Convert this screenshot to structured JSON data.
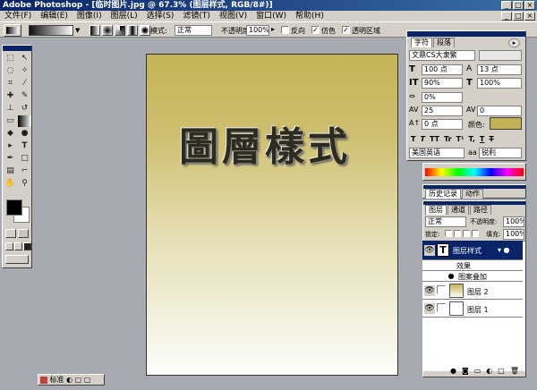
{
  "app": {
    "title": "Adobe Photoshop - [临时图片.jpg @ 67.3% (图层样式, RGB/8#)]",
    "window_buttons": [
      "_",
      "□",
      "×"
    ]
  },
  "menu": [
    "文件(F)",
    "编辑(E)",
    "图像(I)",
    "图层(L)",
    "选择(S)",
    "滤镜(T)",
    "视图(V)",
    "窗口(W)",
    "帮助(H)"
  ],
  "options_bar": {
    "mode_label": "模式:",
    "mode_value": "正常",
    "opacity_label": "不透明度:",
    "opacity_value": "100%",
    "reverse_label": "反向",
    "dither_label": "仿色",
    "transparency_label": "透明区域"
  },
  "canvas": {
    "text": "圖層樣式",
    "gradient_top": "#c4b457",
    "gradient_bottom": "#fdfdfa"
  },
  "char_panel": {
    "tabs": [
      "字符",
      "段落"
    ],
    "font_family": "文鼎CS大隶繁",
    "font_size": "100 点",
    "leading": "13 点",
    "v_scale": "90%",
    "h_scale": "100%",
    "tracking_pct": "0%",
    "kerning": "25",
    "tracking": "0",
    "baseline": "0 点",
    "color_label": "颜色:",
    "color_value": "#c2b256",
    "style_buttons": [
      "T",
      "T",
      "TT",
      "Tr",
      "T¹",
      "T,",
      "T",
      "T"
    ],
    "language": "美国英语",
    "aa_label": "aa",
    "aa_value": "锐利"
  },
  "history_tabs": [
    "历史记录",
    "动作"
  ],
  "layers_panel": {
    "tabs": [
      "图层",
      "通道",
      "路径"
    ],
    "blend_mode": "正常",
    "opacity_label": "不透明度:",
    "opacity_value": "100%",
    "lock_label": "锁定:",
    "fill_label": "填充:",
    "fill_value": "100%",
    "layers": [
      {
        "name": "图层样式",
        "kind": "text",
        "selected": true
      },
      {
        "name": "效果",
        "kind": "effect-group"
      },
      {
        "name": "图案叠加",
        "kind": "effect"
      },
      {
        "name": "图层 2",
        "kind": "image"
      },
      {
        "name": "图层 1",
        "kind": "image"
      }
    ]
  },
  "status": {
    "standard_label": "标准"
  },
  "colors": {
    "foreground": "#000000",
    "background": "#ffffff",
    "title_bar": "#0a246a",
    "selected_layer": "#0a246a"
  }
}
